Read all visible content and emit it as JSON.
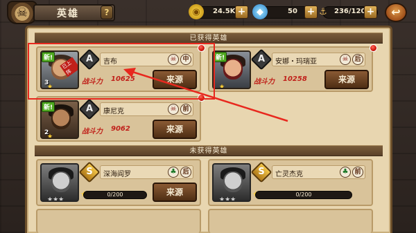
{
  "header": {
    "title": "英雄",
    "help": "?",
    "back": "↩"
  },
  "resources": {
    "gold": "24.5K",
    "gems": "50",
    "stamina": "236/120",
    "plus": "+"
  },
  "sections": {
    "owned": "已获得英雄",
    "unowned": "未获得英雄"
  },
  "owned_heroes": [
    {
      "name": "吉布",
      "rank": "A",
      "position": "中",
      "power_label": "战斗力",
      "power": "10625",
      "source": "来源",
      "new": "新!",
      "owned_tag": "已上阵",
      "level": "3",
      "stars": "★"
    },
    {
      "name": "安娜・玛瑞亚",
      "rank": "A",
      "position": "后",
      "power_label": "战斗力",
      "power": "10258",
      "source": "来源",
      "new": "新!",
      "level": "",
      "stars": "★"
    },
    {
      "name": "康尼克",
      "rank": "A",
      "position": "前",
      "power_label": "战斗力",
      "power": "9062",
      "source": "来源",
      "new": "新!",
      "level": "2",
      "stars": "★"
    }
  ],
  "unowned_heroes": [
    {
      "name": "深海阎罗",
      "rank": "S",
      "position": "后",
      "fragments": "0/200",
      "source": "来源",
      "stars": "★★★"
    },
    {
      "name": "亡灵杰克",
      "rank": "S",
      "position": "前",
      "fragments": "0/200",
      "stars": "★★★"
    }
  ],
  "colors": {
    "accent_red": "#e8281e",
    "power_red": "#c0201a",
    "panel": "#e8d6b0"
  }
}
